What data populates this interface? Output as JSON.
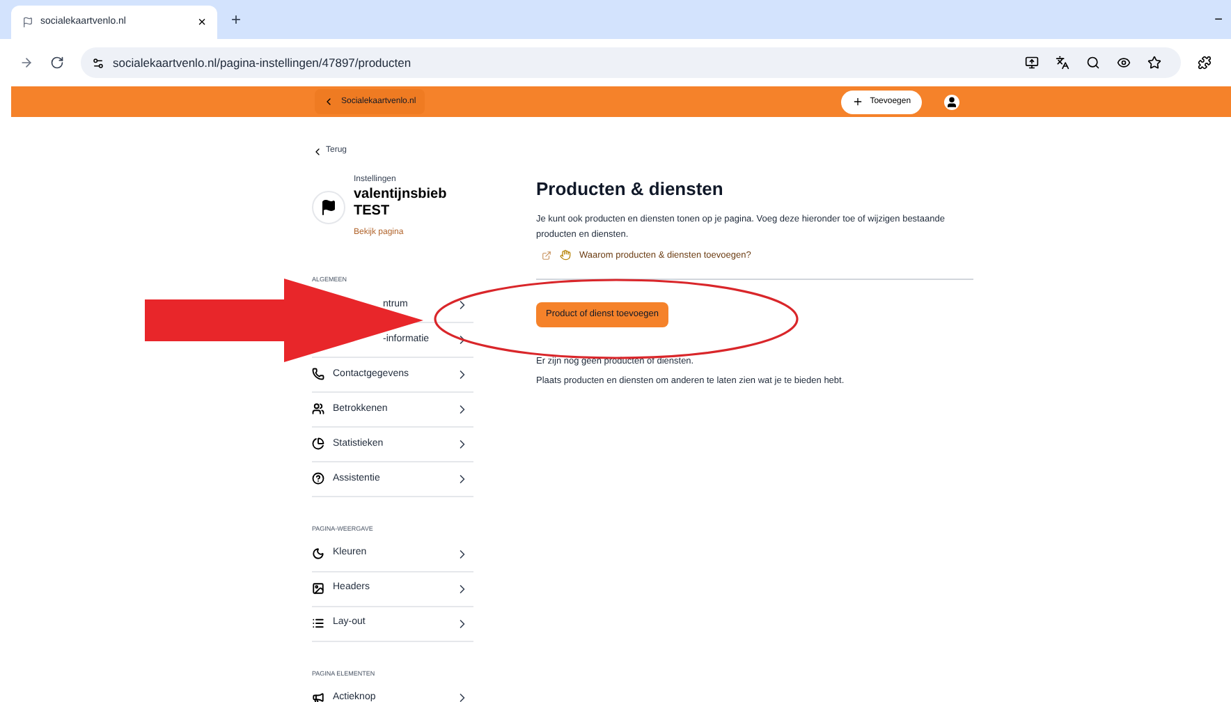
{
  "browser": {
    "tab_title": "socialekaartvenlo.nl",
    "tab_close": "×",
    "new_tab": "+",
    "url": "socialekaartvenlo.nl/pagina-instellingen/47897/producten",
    "minimize": "−"
  },
  "topbar": {
    "back_label": "Socialekaartvenlo.nl",
    "add_button": "Toevoegen"
  },
  "sidebar": {
    "back": "Terug",
    "caption": "Instellingen",
    "name": "valentijnsbieb TEST",
    "view_link": "Bekijk pagina",
    "sections": [
      {
        "heading": "ALGEMEEN",
        "items": [
          {
            "label": "ntrum",
            "kind": "covered"
          },
          {
            "label": "-informatie",
            "kind": "covered"
          },
          {
            "label": "Contactgegevens",
            "kind": "normal"
          },
          {
            "label": "Betrokkenen",
            "kind": "normal"
          },
          {
            "label": "Statistieken",
            "kind": "normal"
          },
          {
            "label": "Assistentie",
            "kind": "normal"
          }
        ]
      },
      {
        "heading": "PAGINA-WEERGAVE",
        "items": [
          {
            "label": "Kleuren",
            "kind": "normal"
          },
          {
            "label": "Headers",
            "kind": "normal"
          },
          {
            "label": "Lay-out",
            "kind": "normal"
          }
        ]
      },
      {
        "heading": "PAGINA ELEMENTEN",
        "items": [
          {
            "label": "Actieknop",
            "kind": "normal"
          }
        ]
      }
    ]
  },
  "main": {
    "title": "Producten & diensten",
    "intro": "Je kunt ook producten en diensten tonen op je pagina. Voeg deze hieronder toe of wijzigen bestaande producten en diensten.",
    "help_link": "Waarom producten & diensten toevoegen?",
    "add_button": "Product of dienst toevoegen",
    "empty_title": "Er zijn nog geen producten of diensten.",
    "empty_text": "Plaats producten en diensten om anderen te laten zien wat je te bieden hebt."
  }
}
